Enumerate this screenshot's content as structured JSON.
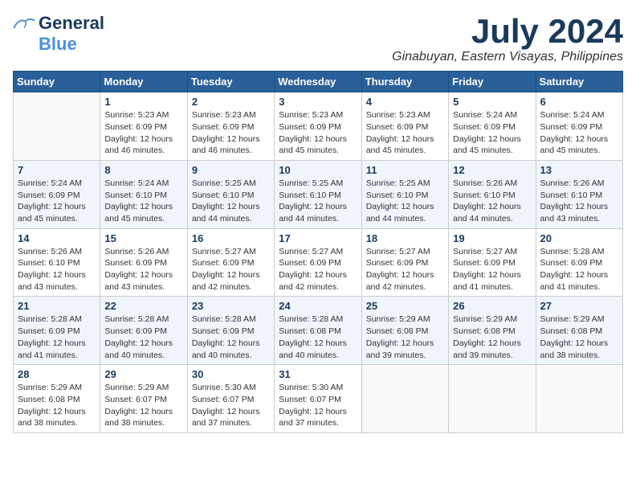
{
  "header": {
    "logo": {
      "general": "General",
      "blue": "Blue",
      "tagline": ""
    },
    "title": "July 2024",
    "location": "Ginabuyan, Eastern Visayas, Philippines"
  },
  "calendar": {
    "days_of_week": [
      "Sunday",
      "Monday",
      "Tuesday",
      "Wednesday",
      "Thursday",
      "Friday",
      "Saturday"
    ],
    "weeks": [
      [
        {
          "day": "",
          "info": ""
        },
        {
          "day": "1",
          "info": "Sunrise: 5:23 AM\nSunset: 6:09 PM\nDaylight: 12 hours\nand 46 minutes."
        },
        {
          "day": "2",
          "info": "Sunrise: 5:23 AM\nSunset: 6:09 PM\nDaylight: 12 hours\nand 46 minutes."
        },
        {
          "day": "3",
          "info": "Sunrise: 5:23 AM\nSunset: 6:09 PM\nDaylight: 12 hours\nand 45 minutes."
        },
        {
          "day": "4",
          "info": "Sunrise: 5:23 AM\nSunset: 6:09 PM\nDaylight: 12 hours\nand 45 minutes."
        },
        {
          "day": "5",
          "info": "Sunrise: 5:24 AM\nSunset: 6:09 PM\nDaylight: 12 hours\nand 45 minutes."
        },
        {
          "day": "6",
          "info": "Sunrise: 5:24 AM\nSunset: 6:09 PM\nDaylight: 12 hours\nand 45 minutes."
        }
      ],
      [
        {
          "day": "7",
          "info": "Sunrise: 5:24 AM\nSunset: 6:09 PM\nDaylight: 12 hours\nand 45 minutes."
        },
        {
          "day": "8",
          "info": "Sunrise: 5:24 AM\nSunset: 6:10 PM\nDaylight: 12 hours\nand 45 minutes."
        },
        {
          "day": "9",
          "info": "Sunrise: 5:25 AM\nSunset: 6:10 PM\nDaylight: 12 hours\nand 44 minutes."
        },
        {
          "day": "10",
          "info": "Sunrise: 5:25 AM\nSunset: 6:10 PM\nDaylight: 12 hours\nand 44 minutes."
        },
        {
          "day": "11",
          "info": "Sunrise: 5:25 AM\nSunset: 6:10 PM\nDaylight: 12 hours\nand 44 minutes."
        },
        {
          "day": "12",
          "info": "Sunrise: 5:26 AM\nSunset: 6:10 PM\nDaylight: 12 hours\nand 44 minutes."
        },
        {
          "day": "13",
          "info": "Sunrise: 5:26 AM\nSunset: 6:10 PM\nDaylight: 12 hours\nand 43 minutes."
        }
      ],
      [
        {
          "day": "14",
          "info": "Sunrise: 5:26 AM\nSunset: 6:10 PM\nDaylight: 12 hours\nand 43 minutes."
        },
        {
          "day": "15",
          "info": "Sunrise: 5:26 AM\nSunset: 6:09 PM\nDaylight: 12 hours\nand 43 minutes."
        },
        {
          "day": "16",
          "info": "Sunrise: 5:27 AM\nSunset: 6:09 PM\nDaylight: 12 hours\nand 42 minutes."
        },
        {
          "day": "17",
          "info": "Sunrise: 5:27 AM\nSunset: 6:09 PM\nDaylight: 12 hours\nand 42 minutes."
        },
        {
          "day": "18",
          "info": "Sunrise: 5:27 AM\nSunset: 6:09 PM\nDaylight: 12 hours\nand 42 minutes."
        },
        {
          "day": "19",
          "info": "Sunrise: 5:27 AM\nSunset: 6:09 PM\nDaylight: 12 hours\nand 41 minutes."
        },
        {
          "day": "20",
          "info": "Sunrise: 5:28 AM\nSunset: 6:09 PM\nDaylight: 12 hours\nand 41 minutes."
        }
      ],
      [
        {
          "day": "21",
          "info": "Sunrise: 5:28 AM\nSunset: 6:09 PM\nDaylight: 12 hours\nand 41 minutes."
        },
        {
          "day": "22",
          "info": "Sunrise: 5:28 AM\nSunset: 6:09 PM\nDaylight: 12 hours\nand 40 minutes."
        },
        {
          "day": "23",
          "info": "Sunrise: 5:28 AM\nSunset: 6:09 PM\nDaylight: 12 hours\nand 40 minutes."
        },
        {
          "day": "24",
          "info": "Sunrise: 5:28 AM\nSunset: 6:08 PM\nDaylight: 12 hours\nand 40 minutes."
        },
        {
          "day": "25",
          "info": "Sunrise: 5:29 AM\nSunset: 6:08 PM\nDaylight: 12 hours\nand 39 minutes."
        },
        {
          "day": "26",
          "info": "Sunrise: 5:29 AM\nSunset: 6:08 PM\nDaylight: 12 hours\nand 39 minutes."
        },
        {
          "day": "27",
          "info": "Sunrise: 5:29 AM\nSunset: 6:08 PM\nDaylight: 12 hours\nand 38 minutes."
        }
      ],
      [
        {
          "day": "28",
          "info": "Sunrise: 5:29 AM\nSunset: 6:08 PM\nDaylight: 12 hours\nand 38 minutes."
        },
        {
          "day": "29",
          "info": "Sunrise: 5:29 AM\nSunset: 6:07 PM\nDaylight: 12 hours\nand 38 minutes."
        },
        {
          "day": "30",
          "info": "Sunrise: 5:30 AM\nSunset: 6:07 PM\nDaylight: 12 hours\nand 37 minutes."
        },
        {
          "day": "31",
          "info": "Sunrise: 5:30 AM\nSunset: 6:07 PM\nDaylight: 12 hours\nand 37 minutes."
        },
        {
          "day": "",
          "info": ""
        },
        {
          "day": "",
          "info": ""
        },
        {
          "day": "",
          "info": ""
        }
      ]
    ]
  }
}
